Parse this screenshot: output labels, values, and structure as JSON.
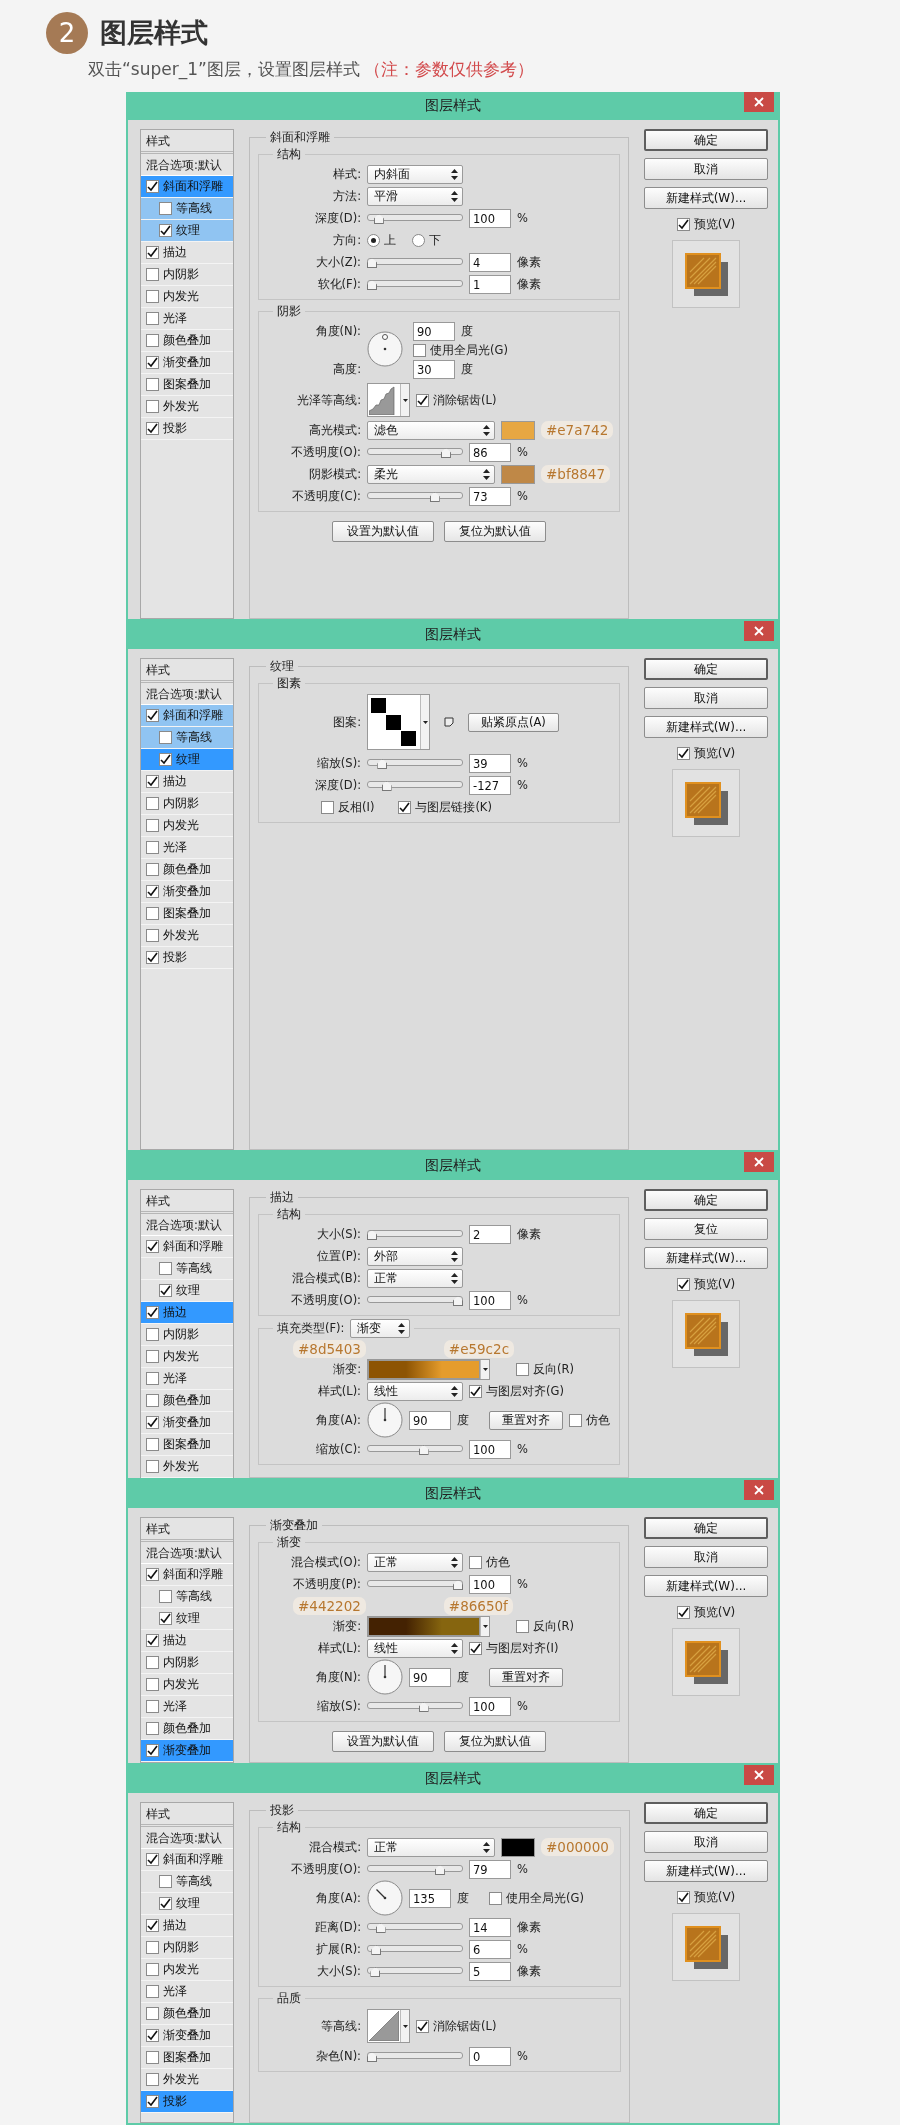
{
  "header": {
    "step": "2",
    "title": "图层样式",
    "subtitle": "双击“super_1”图层，设置图层样式",
    "note": "（注：参数仅供参考）"
  },
  "dialogs": [
    {
      "title": "图层样式",
      "styles": {
        "heading": "样式",
        "blend": "混合选项:默认",
        "items": [
          {
            "label": "斜面和浮雕",
            "checked": true,
            "selected": true,
            "children": [
              {
                "label": "等高线",
                "checked": false,
                "selected": false
              },
              {
                "label": "纹理",
                "checked": true,
                "selected": false
              }
            ]
          },
          {
            "label": "描边",
            "checked": true,
            "selected": false
          },
          {
            "label": "内阴影",
            "checked": false,
            "selected": false
          },
          {
            "label": "内发光",
            "checked": false,
            "selected": false
          },
          {
            "label": "光泽",
            "checked": false,
            "selected": false
          },
          {
            "label": "颜色叠加",
            "checked": false,
            "selected": false
          },
          {
            "label": "渐变叠加",
            "checked": true,
            "selected": false
          },
          {
            "label": "图案叠加",
            "checked": false,
            "selected": false
          },
          {
            "label": "外发光",
            "checked": false,
            "selected": false
          },
          {
            "label": "投影",
            "checked": true,
            "selected": false
          }
        ]
      },
      "panel": {
        "title": "斜面和浮雕",
        "groups": [
          {
            "legend": {
              "kind": "text",
              "label": "结构"
            },
            "rows": [
              {
                "kind": "select",
                "label": "样式:",
                "value": "内斜面"
              },
              {
                "kind": "select",
                "label": "方法:",
                "value": "平滑"
              },
              {
                "kind": "slider",
                "label": "深度(D):",
                "level": 0.08,
                "value": "100",
                "unit": "%"
              },
              {
                "kind": "radio",
                "label": "方向:",
                "options": [
                  {
                    "label": "上",
                    "selected": true
                  },
                  {
                    "label": "下",
                    "selected": false
                  }
                ]
              },
              {
                "kind": "slider",
                "label": "大小(Z):",
                "level": 0,
                "value": "4",
                "unit": "像素"
              },
              {
                "kind": "slider",
                "label": "软化(F):",
                "level": 0,
                "value": "1",
                "unit": "像素"
              }
            ]
          },
          {
            "legend": {
              "kind": "text",
              "label": "阴影"
            },
            "rows": [
              {
                "kind": "light",
                "label": "角度(N):",
                "value": "90",
                "unit": "度",
                "second_label": "高度:",
                "second_value": "30",
                "second_unit": "度",
                "after": [
                  {
                    "kind": "checkbox",
                    "label": "使用全局光(G)",
                    "checked": false
                  }
                ]
              },
              {
                "kind": "contour",
                "label": "光泽等高线:",
                "curve": {
                  "kind": "stepped"
                },
                "after": [
                  {
                    "kind": "checkbox",
                    "label": "消除锯齿(L)",
                    "checked": true
                  }
                ]
              },
              {
                "kind": "select",
                "label": "高光模式:",
                "value": "滤色",
                "color": "#e7a742",
                "tag": "#e7a742"
              },
              {
                "kind": "slider",
                "label": "不透明度(O):",
                "level": 0.86,
                "value": "86",
                "unit": "%"
              },
              {
                "kind": "select",
                "label": "阴影模式:",
                "value": "柔光",
                "color": "#bf8847",
                "tag": "#bf8847"
              },
              {
                "kind": "slider",
                "label": "不透明度(C):",
                "level": 0.73,
                "value": "73",
                "unit": "%"
              }
            ]
          }
        ],
        "buttons": [
          "设置为默认值",
          "复位为默认值"
        ]
      },
      "actions": [
        {
          "label": "确定",
          "default": true
        },
        {
          "label": "取消",
          "default": false
        },
        {
          "label": "新建样式(W)...",
          "default": false
        }
      ],
      "preview": {
        "label": "预览(V)",
        "checked": true
      }
    },
    {
      "title": "图层样式",
      "styles": {
        "heading": "样式",
        "blend": "混合选项:默认",
        "items": [
          {
            "label": "斜面和浮雕",
            "checked": true,
            "selected": false,
            "children": [
              {
                "label": "等高线",
                "checked": false,
                "selected": false
              },
              {
                "label": "纹理",
                "checked": true,
                "selected": true
              }
            ]
          },
          {
            "label": "描边",
            "checked": true,
            "selected": false
          },
          {
            "label": "内阴影",
            "checked": false,
            "selected": false
          },
          {
            "label": "内发光",
            "checked": false,
            "selected": false
          },
          {
            "label": "光泽",
            "checked": false,
            "selected": false
          },
          {
            "label": "颜色叠加",
            "checked": false,
            "selected": false
          },
          {
            "label": "渐变叠加",
            "checked": true,
            "selected": false
          },
          {
            "label": "图案叠加",
            "checked": false,
            "selected": false
          },
          {
            "label": "外发光",
            "checked": false,
            "selected": false
          },
          {
            "label": "投影",
            "checked": true,
            "selected": false
          }
        ]
      },
      "panel": {
        "title": "纹理",
        "groups": [
          {
            "legend": {
              "kind": "text",
              "label": "图素"
            },
            "rows": [
              {
                "kind": "pattern",
                "label": "图案:",
                "after": [
                  {
                    "kind": "button",
                    "label": "贴紧原点(A)"
                  }
                ]
              },
              {
                "kind": "slider",
                "label": "缩放(S):",
                "level": 0.12,
                "value": "39",
                "unit": "%"
              },
              {
                "kind": "slider",
                "label": "深度(D):",
                "level": 0.17,
                "value": "-127",
                "unit": "%"
              },
              {
                "kind": "checks",
                "after": [
                  {
                    "kind": "checkbox",
                    "label": "反相(I)",
                    "checked": false
                  },
                  {
                    "kind": "checkbox",
                    "label": "与图层链接(K)",
                    "checked": true
                  }
                ]
              }
            ]
          }
        ]
      },
      "actions": [
        {
          "label": "确定",
          "default": true
        },
        {
          "label": "取消",
          "default": false
        },
        {
          "label": "新建样式(W)...",
          "default": false
        }
      ],
      "preview": {
        "label": "预览(V)",
        "checked": true
      }
    },
    {
      "title": "图层样式",
      "styles": {
        "heading": "样式",
        "blend": "混合选项:默认",
        "items": [
          {
            "label": "斜面和浮雕",
            "checked": true,
            "selected": false,
            "children": [
              {
                "label": "等高线",
                "checked": false,
                "selected": false
              },
              {
                "label": "纹理",
                "checked": true,
                "selected": false
              }
            ]
          },
          {
            "label": "描边",
            "checked": true,
            "selected": true
          },
          {
            "label": "内阴影",
            "checked": false,
            "selected": false
          },
          {
            "label": "内发光",
            "checked": false,
            "selected": false
          },
          {
            "label": "光泽",
            "checked": false,
            "selected": false
          },
          {
            "label": "颜色叠加",
            "checked": false,
            "selected": false
          },
          {
            "label": "渐变叠加",
            "checked": true,
            "selected": false
          },
          {
            "label": "图案叠加",
            "checked": false,
            "selected": false
          },
          {
            "label": "外发光",
            "checked": false,
            "selected": false
          }
        ]
      },
      "panel": {
        "title": "描边",
        "groups": [
          {
            "legend": {
              "kind": "text",
              "label": "结构"
            },
            "rows": [
              {
                "kind": "slider",
                "label": "大小(S):",
                "level": 0,
                "value": "2",
                "unit": "像素"
              },
              {
                "kind": "select",
                "label": "位置(P):",
                "value": "外部"
              },
              {
                "kind": "select",
                "label": "混合模式(B):",
                "value": "正常"
              },
              {
                "kind": "slider",
                "label": "不透明度(O):",
                "level": 1,
                "value": "100",
                "unit": "%"
              }
            ]
          },
          {
            "legend": {
              "kind": "select",
              "label": "填充类型(F):",
              "value": "渐变"
            },
            "rows": [
              {
                "kind": "gradient",
                "label": "渐变:",
                "stops": [
                  {
                    "color": "#8d5403",
                    "tag": "#8d5403"
                  },
                  {
                    "color": "#e59c2c",
                    "tag": "#e59c2c"
                  }
                ],
                "after": [
                  {
                    "kind": "checkbox",
                    "label": "反向(R)",
                    "checked": false
                  }
                ]
              },
              {
                "kind": "select",
                "label": "样式(L):",
                "value": "线性",
                "after": [
                  {
                    "kind": "checkbox",
                    "label": "与图层对齐(G)",
                    "checked": true
                  }
                ]
              },
              {
                "kind": "angle",
                "label": "角度(A):",
                "value": "90",
                "unit": "度",
                "after": [
                  {
                    "kind": "button",
                    "label": "重置对齐"
                  },
                  {
                    "kind": "checkbox",
                    "label": "仿色",
                    "checked": false
                  }
                ]
              },
              {
                "kind": "slider",
                "label": "缩放(C):",
                "level": 0.6,
                "value": "100",
                "unit": "%"
              }
            ]
          }
        ]
      },
      "actions": [
        {
          "label": "确定",
          "default": true
        },
        {
          "label": "复位",
          "default": false
        },
        {
          "label": "新建样式(W)...",
          "default": false
        }
      ],
      "preview": {
        "label": "预览(V)",
        "checked": true
      }
    },
    {
      "title": "图层样式",
      "styles": {
        "heading": "样式",
        "blend": "混合选项:默认",
        "items": [
          {
            "label": "斜面和浮雕",
            "checked": true,
            "selected": false,
            "children": [
              {
                "label": "等高线",
                "checked": false,
                "selected": false
              },
              {
                "label": "纹理",
                "checked": true,
                "selected": false
              }
            ]
          },
          {
            "label": "描边",
            "checked": true,
            "selected": false
          },
          {
            "label": "内阴影",
            "checked": false,
            "selected": false
          },
          {
            "label": "内发光",
            "checked": false,
            "selected": false
          },
          {
            "label": "光泽",
            "checked": false,
            "selected": false
          },
          {
            "label": "颜色叠加",
            "checked": false,
            "selected": false
          },
          {
            "label": "渐变叠加",
            "checked": true,
            "selected": true
          }
        ]
      },
      "panel": {
        "title": "渐变叠加",
        "groups": [
          {
            "legend": {
              "kind": "text",
              "label": "渐变"
            },
            "rows": [
              {
                "kind": "select",
                "label": "混合模式(O):",
                "value": "正常",
                "after": [
                  {
                    "kind": "checkbox",
                    "label": "仿色",
                    "checked": false
                  }
                ]
              },
              {
                "kind": "slider",
                "label": "不透明度(P):",
                "level": 1,
                "value": "100",
                "unit": "%"
              },
              {
                "kind": "gradient",
                "label": "渐变:",
                "stops": [
                  {
                    "color": "#442202",
                    "tag": "#442202"
                  },
                  {
                    "color": "#86650f",
                    "tag": "#86650f"
                  }
                ],
                "after": [
                  {
                    "kind": "checkbox",
                    "label": "反向(R)",
                    "checked": false
                  }
                ]
              },
              {
                "kind": "select",
                "label": "样式(L):",
                "value": "线性",
                "after": [
                  {
                    "kind": "checkbox",
                    "label": "与图层对齐(I)",
                    "checked": true
                  }
                ]
              },
              {
                "kind": "angle",
                "label": "角度(N):",
                "value": "90",
                "unit": "度",
                "after": [
                  {
                    "kind": "button",
                    "label": "重置对齐"
                  }
                ]
              },
              {
                "kind": "slider",
                "label": "缩放(S):",
                "level": 0.6,
                "value": "100",
                "unit": "%"
              }
            ]
          }
        ],
        "buttons": [
          "设置为默认值",
          "复位为默认值"
        ]
      },
      "actions": [
        {
          "label": "确定",
          "default": true
        },
        {
          "label": "取消",
          "default": false
        },
        {
          "label": "新建样式(W)...",
          "default": false
        }
      ],
      "preview": {
        "label": "预览(V)",
        "checked": true
      }
    },
    {
      "title": "图层样式",
      "styles": {
        "heading": "样式",
        "blend": "混合选项:默认",
        "items": [
          {
            "label": "斜面和浮雕",
            "checked": true,
            "selected": false,
            "children": [
              {
                "label": "等高线",
                "checked": false,
                "selected": false
              },
              {
                "label": "纹理",
                "checked": true,
                "selected": false
              }
            ]
          },
          {
            "label": "描边",
            "checked": true,
            "selected": false
          },
          {
            "label": "内阴影",
            "checked": false,
            "selected": false
          },
          {
            "label": "内发光",
            "checked": false,
            "selected": false
          },
          {
            "label": "光泽",
            "checked": false,
            "selected": false
          },
          {
            "label": "颜色叠加",
            "checked": false,
            "selected": false
          },
          {
            "label": "渐变叠加",
            "checked": true,
            "selected": false
          },
          {
            "label": "图案叠加",
            "checked": false,
            "selected": false
          },
          {
            "label": "外发光",
            "checked": false,
            "selected": false
          },
          {
            "label": "投影",
            "checked": true,
            "selected": true
          }
        ]
      },
      "panel": {
        "title": "投影",
        "groups": [
          {
            "legend": {
              "kind": "text",
              "label": "结构"
            },
            "rows": [
              {
                "kind": "select",
                "label": "混合模式:",
                "value": "正常",
                "color": "#000000",
                "tag": "#000000"
              },
              {
                "kind": "slider",
                "label": "不透明度(O):",
                "level": 0.79,
                "value": "79",
                "unit": "%"
              },
              {
                "kind": "angle",
                "label": "角度(A):",
                "value": "135",
                "unit": "度",
                "after": [
                  {
                    "kind": "checkbox",
                    "label": "使用全局光(G)",
                    "checked": false
                  }
                ]
              },
              {
                "kind": "slider",
                "label": "距离(D):",
                "level": 0.1,
                "value": "14",
                "unit": "像素"
              },
              {
                "kind": "slider",
                "label": "扩展(R):",
                "level": 0.05,
                "value": "6",
                "unit": "%"
              },
              {
                "kind": "slider",
                "label": "大小(S):",
                "level": 0.04,
                "value": "5",
                "unit": "像素"
              }
            ]
          },
          {
            "legend": {
              "kind": "text",
              "label": "品质"
            },
            "rows": [
              {
                "kind": "contour",
                "label": "等高线:",
                "curve": {
                  "kind": "linear"
                },
                "after": [
                  {
                    "kind": "checkbox",
                    "label": "消除锯齿(L)",
                    "checked": true
                  }
                ]
              },
              {
                "kind": "slider",
                "label": "杂色(N):",
                "level": 0,
                "value": "0",
                "unit": "%"
              }
            ]
          }
        ]
      },
      "actions": [
        {
          "label": "确定",
          "default": true
        },
        {
          "label": "取消",
          "default": false
        },
        {
          "label": "新建样式(W)...",
          "default": false
        }
      ],
      "preview": {
        "label": "预览(V)",
        "checked": true
      }
    }
  ]
}
